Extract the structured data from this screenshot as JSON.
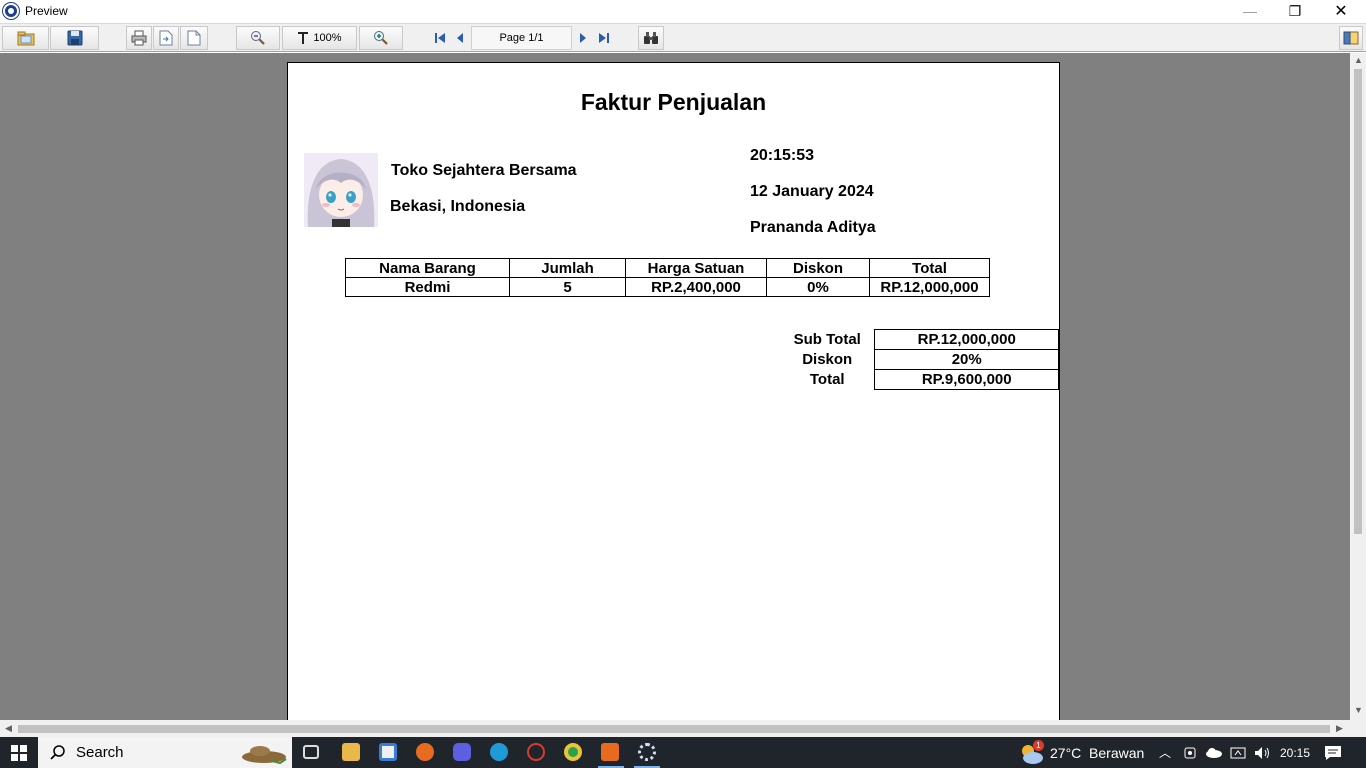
{
  "window": {
    "title": "Preview",
    "minimize": "—",
    "restore": "❐",
    "close": "✕"
  },
  "toolbar": {
    "zoom": "100%",
    "page": "Page 1/1"
  },
  "invoice": {
    "title": "Faktur Penjualan",
    "store_name": "Toko Sejahtera Bersama",
    "store_location": "Bekasi, Indonesia",
    "time": "20:15:53",
    "date": "12 January 2024",
    "cashier": "Prananda Aditya",
    "columns": [
      "Nama Barang",
      "Jumlah",
      "Harga Satuan",
      "Diskon",
      "Total"
    ],
    "rows": [
      {
        "name": "Redmi",
        "qty": "5",
        "price": "RP.2,400,000",
        "discount": "0%",
        "total": "RP.12,000,000"
      }
    ],
    "summary": {
      "subtotal_label": "Sub Total",
      "subtotal": "RP.12,000,000",
      "discount_label": "Diskon",
      "discount": "20%",
      "total_label": "Total",
      "total": "RP.9,600,000"
    }
  },
  "taskbar": {
    "search_label": "Search",
    "weather": "27°C  Berawan",
    "weather_badge": "1",
    "clock": "20:15"
  }
}
